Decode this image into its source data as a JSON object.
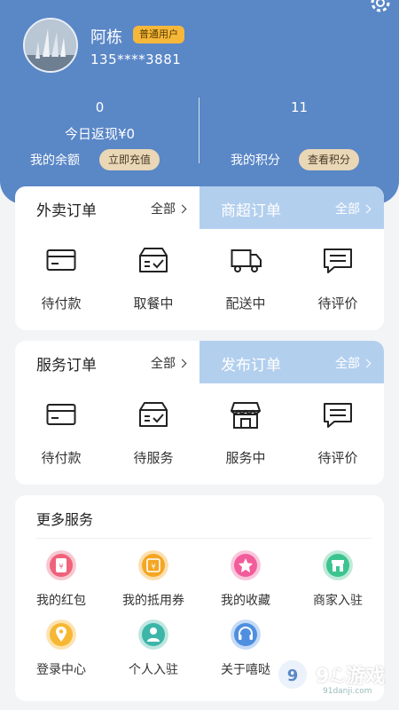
{
  "user": {
    "name": "阿栋",
    "badge": "普通用户",
    "phone": "135****3881"
  },
  "stats": {
    "left": {
      "value": "0",
      "sub": "今日返现¥0",
      "label": "我的余额",
      "action": "立即充值"
    },
    "right": {
      "value": "11",
      "label": "我的积分",
      "action": "查看积分"
    }
  },
  "takeout": {
    "tab_left": "外卖订单",
    "tab_left_all": "全部",
    "tab_right": "商超订单",
    "tab_right_all": "全部",
    "items": [
      {
        "label": "待付款",
        "icon": "card-icon"
      },
      {
        "label": "取餐中",
        "icon": "box-check-icon"
      },
      {
        "label": "配送中",
        "icon": "truck-icon"
      },
      {
        "label": "待评价",
        "icon": "chat-icon"
      }
    ]
  },
  "service": {
    "tab_left": "服务订单",
    "tab_left_all": "全部",
    "tab_right": "发布订单",
    "tab_right_all": "全部",
    "items": [
      {
        "label": "待付款",
        "icon": "card-icon"
      },
      {
        "label": "待服务",
        "icon": "box-check-icon"
      },
      {
        "label": "服务中",
        "icon": "store-icon"
      },
      {
        "label": "待评价",
        "icon": "chat-icon"
      }
    ]
  },
  "more": {
    "title": "更多服务",
    "items": [
      {
        "label": "我的红包",
        "icon": "red-packet-icon",
        "color": "#f0627a"
      },
      {
        "label": "我的抵用券",
        "icon": "coupon-icon",
        "color": "#f5a623"
      },
      {
        "label": "我的收藏",
        "icon": "star-icon",
        "color": "#f25c9a"
      },
      {
        "label": "商家入驻",
        "icon": "shop-icon",
        "color": "#3cc48f"
      },
      {
        "label": "登录中心",
        "icon": "location-icon",
        "color": "#f7b733"
      },
      {
        "label": "个人入驻",
        "icon": "person-icon",
        "color": "#3bb6a8"
      },
      {
        "label": "关于嘻哒",
        "icon": "headset-icon",
        "color": "#4f8fe0"
      }
    ]
  },
  "watermark": {
    "text": "9ℒ游戏",
    "url": "91danji.com"
  }
}
